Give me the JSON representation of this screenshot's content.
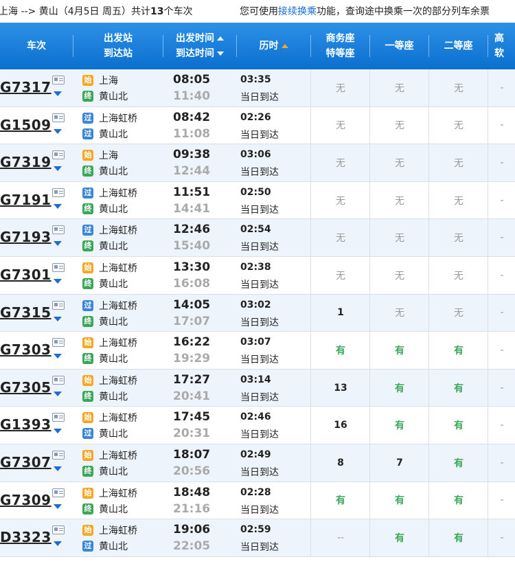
{
  "topbar": {
    "route_prefix": "上海 --> 黄山（4月5日  周五）共计",
    "count": "13",
    "route_suffix": "个车次",
    "hint_prefix": "您可使用",
    "hint_link": "接续换乘",
    "hint_suffix": "功能，查询途中换乘一次的部分列车余票"
  },
  "header": {
    "train": "车次",
    "station_depart": "出发站",
    "station_arrive": "到达站",
    "time_depart": "出发时间",
    "time_arrive": "到达时间",
    "duration": "历时",
    "business": "商务座",
    "premium": "特等座",
    "first": "一等座",
    "second": "二等座",
    "more1": "高",
    "more2": "软"
  },
  "badges": {
    "start": "始",
    "pass": "过",
    "end": "终"
  },
  "trains": [
    {
      "no": "G7317",
      "from": "上海",
      "from_type": "start",
      "to": "黄山北",
      "to_type": "end",
      "dep": "08:05",
      "arr": "11:40",
      "dur": "03:35",
      "arrive_note": "当日到达",
      "biz": "无",
      "first": "无",
      "second": "无",
      "more": "-"
    },
    {
      "no": "G1509",
      "from": "上海虹桥",
      "from_type": "pass",
      "to": "黄山北",
      "to_type": "pass",
      "dep": "08:42",
      "arr": "11:08",
      "dur": "02:26",
      "arrive_note": "当日到达",
      "biz": "无",
      "first": "无",
      "second": "无",
      "more": "-"
    },
    {
      "no": "G7319",
      "from": "上海",
      "from_type": "start",
      "to": "黄山北",
      "to_type": "end",
      "dep": "09:38",
      "arr": "12:44",
      "dur": "03:06",
      "arrive_note": "当日到达",
      "biz": "无",
      "first": "无",
      "second": "无",
      "more": "-"
    },
    {
      "no": "G7191",
      "from": "上海虹桥",
      "from_type": "pass",
      "to": "黄山北",
      "to_type": "end",
      "dep": "11:51",
      "arr": "14:41",
      "dur": "02:50",
      "arrive_note": "当日到达",
      "biz": "无",
      "first": "无",
      "second": "无",
      "more": "-"
    },
    {
      "no": "G7193",
      "from": "上海虹桥",
      "from_type": "pass",
      "to": "黄山北",
      "to_type": "end",
      "dep": "12:46",
      "arr": "15:40",
      "dur": "02:54",
      "arrive_note": "当日到达",
      "biz": "无",
      "first": "无",
      "second": "无",
      "more": "-"
    },
    {
      "no": "G7301",
      "from": "上海虹桥",
      "from_type": "start",
      "to": "黄山北",
      "to_type": "end",
      "dep": "13:30",
      "arr": "16:08",
      "dur": "02:38",
      "arrive_note": "当日到达",
      "biz": "无",
      "first": "无",
      "second": "无",
      "more": "-"
    },
    {
      "no": "G7315",
      "from": "上海虹桥",
      "from_type": "pass",
      "to": "黄山北",
      "to_type": "end",
      "dep": "14:05",
      "arr": "17:07",
      "dur": "03:02",
      "arrive_note": "当日到达",
      "biz": "1",
      "first": "无",
      "second": "无",
      "more": "-"
    },
    {
      "no": "G7303",
      "from": "上海虹桥",
      "from_type": "start",
      "to": "黄山北",
      "to_type": "end",
      "dep": "16:22",
      "arr": "19:29",
      "dur": "03:07",
      "arrive_note": "当日到达",
      "biz": "有",
      "first": "有",
      "second": "有",
      "more": "-"
    },
    {
      "no": "G7305",
      "from": "上海虹桥",
      "from_type": "start",
      "to": "黄山北",
      "to_type": "end",
      "dep": "17:27",
      "arr": "20:41",
      "dur": "03:14",
      "arrive_note": "当日到达",
      "biz": "13",
      "first": "有",
      "second": "有",
      "more": "-"
    },
    {
      "no": "G1393",
      "from": "上海虹桥",
      "from_type": "start",
      "to": "黄山北",
      "to_type": "pass",
      "dep": "17:45",
      "arr": "20:31",
      "dur": "02:46",
      "arrive_note": "当日到达",
      "biz": "16",
      "first": "有",
      "second": "有",
      "more": "-"
    },
    {
      "no": "G7307",
      "from": "上海虹桥",
      "from_type": "start",
      "to": "黄山北",
      "to_type": "end",
      "dep": "18:07",
      "arr": "20:56",
      "dur": "02:49",
      "arrive_note": "当日到达",
      "biz": "8",
      "first": "7",
      "second": "有",
      "more": "-"
    },
    {
      "no": "G7309",
      "from": "上海虹桥",
      "from_type": "start",
      "to": "黄山北",
      "to_type": "end",
      "dep": "18:48",
      "arr": "21:16",
      "dur": "02:28",
      "arrive_note": "当日到达",
      "biz": "有",
      "first": "有",
      "second": "有",
      "more": "-"
    },
    {
      "no": "D3323",
      "from": "上海虹桥",
      "from_type": "start",
      "to": "黄山北",
      "to_type": "pass",
      "dep": "19:06",
      "arr": "22:05",
      "dur": "02:59",
      "arrive_note": "当日到达",
      "biz": "--",
      "first": "有",
      "second": "有",
      "more": "-"
    }
  ]
}
